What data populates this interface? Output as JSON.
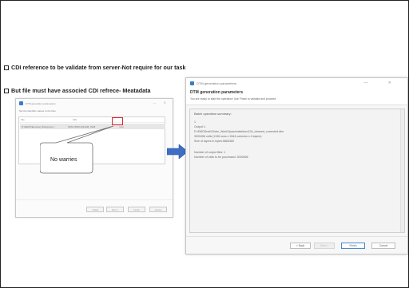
{
  "bullets": [
    "CDI reference to be validate from server-Not require for our task",
    "But file must have associed CDI refrece- Meatadata"
  ],
  "left_dialog": {
    "title": "DTM generation parameters",
    "subtitle": "Set the identifier values to the files",
    "columns": [
      "File",
      "CDI"
    ],
    "row": {
      "file": "D:\\DEMO\\Emodnet_Bathymetry\\...",
      "cdi": "SDN:CPRD:1234-DB_0348",
      "status": "Valid"
    },
    "buttons": [
      "< Back",
      "Next >",
      "Finish",
      "Cancel"
    ]
  },
  "callout": {
    "text": "No warries"
  },
  "right_dialog": {
    "title": "DTM generation parameters",
    "header_title": "DTM generation parameters",
    "header_sub": "You are ready to start the operation! Use Finish to validate and proceed.",
    "summary_title": "Batch operation summary:",
    "lines": [
      "1",
      "Output 1:",
      "D:\\EMODnet\\Globe_Work\\Space\\data\\tom134_cleaned_corrected.dtm",
      "3009456 cells (1136 rows x 2644 columns x 4 layers)",
      "Size of layers in bytes:5883360",
      "",
      "Number of output files: 1",
      "Number of cells to be processed: 3009456"
    ],
    "buttons": [
      "< Back",
      "Next >",
      "Finish",
      "Cancel"
    ]
  },
  "colors": {
    "highlight_box": "#e0262a",
    "arrow": "#3f6fc4"
  }
}
